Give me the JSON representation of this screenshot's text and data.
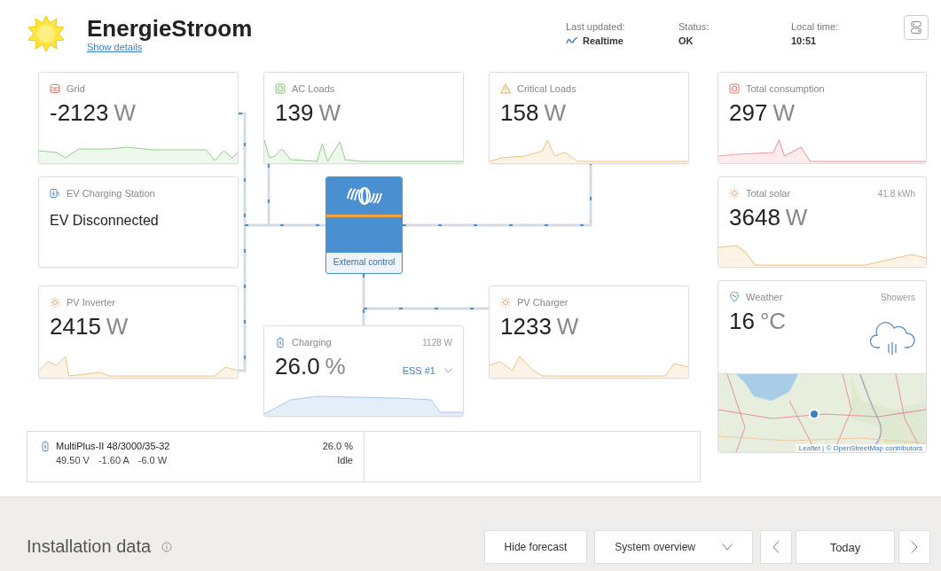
{
  "header": {
    "title": "EnergieStroom",
    "details_link": "Show details",
    "status": [
      {
        "kind": "live",
        "label": "Last updated:",
        "value": "Realtime"
      },
      {
        "kind": "plain",
        "label": "Status:",
        "value": "OK"
      },
      {
        "kind": "plain",
        "label": "Local time:",
        "value": "10:51"
      }
    ]
  },
  "diagram": {
    "cards": [
      {
        "kind": "grid",
        "title": "Grid",
        "value": "-2123",
        "unit": "W"
      },
      {
        "kind": "ev",
        "title": "EV Charging Station",
        "status": "EV Disconnected"
      },
      {
        "kind": "pv_inverter",
        "title": "PV Inverter",
        "value": "2415",
        "unit": "W"
      },
      {
        "kind": "ac_loads",
        "title": "AC Loads",
        "value": "139",
        "unit": "W"
      },
      {
        "kind": "critical",
        "title": "Critical Loads",
        "value": "158",
        "unit": "W"
      },
      {
        "kind": "pv_charger",
        "title": "PV Charger",
        "value": "1233",
        "unit": "W"
      },
      {
        "kind": "battery",
        "title": "Charging",
        "value": "26.0",
        "unit": "%",
        "power": "1128 W",
        "selector": "ESS #1"
      }
    ],
    "inverter": {
      "label": "External control"
    },
    "device": {
      "name": "MultiPlus-II 48/3000/35-32",
      "readings": [
        "49.50 V",
        "-1.60 A",
        "-6.0 W"
      ],
      "soc": "26.0 %",
      "state": "Idle"
    }
  },
  "side": {
    "cards": [
      {
        "kind": "consumption",
        "title": "Total consumption",
        "value": "297",
        "unit": "W"
      },
      {
        "kind": "solar",
        "title": "Total solar",
        "value": "3648",
        "unit": "W",
        "extra": "41.8 kWh"
      }
    ],
    "weather": {
      "title": "Weather",
      "condition": "Showers",
      "value": "16",
      "unit": "°C",
      "attribution": "Leaflet | © OpenStreetMap contributors"
    }
  },
  "footer": {
    "title": "Installation data",
    "buttons": [
      "Hide forecast"
    ],
    "dropdown": "System overview",
    "date": "Today"
  }
}
